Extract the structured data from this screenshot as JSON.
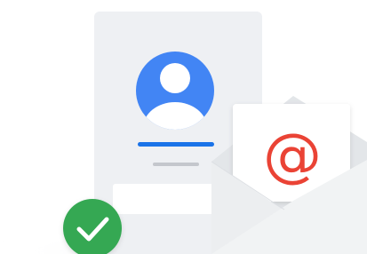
{
  "illustration": {
    "envelope_symbol": "@",
    "icons": {
      "profile": "account-avatar-icon",
      "check": "check-icon",
      "mail": "at-sign-icon"
    },
    "colors": {
      "card_bg": "#eef0f3",
      "avatar_blue": "#4285f4",
      "accent_blue": "#1a73e8",
      "check_green": "#34a853",
      "at_red": "#ea4335",
      "envelope_light": "#f1f3f4",
      "envelope_mid": "#e3e6e9",
      "placeholder_line": "#c4c7cc"
    }
  }
}
